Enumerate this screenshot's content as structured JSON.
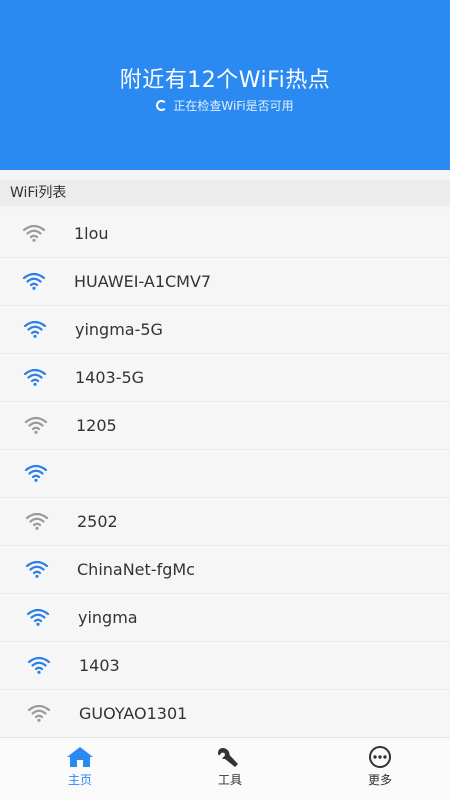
{
  "header": {
    "title": "附近有12个WiFi热点",
    "status": "正在检查WiFi是否可用"
  },
  "list": {
    "section_title": "WiFi列表",
    "items": [
      {
        "ssid": "1lou",
        "icon": "wifi-weak-icon"
      },
      {
        "ssid": "HUAWEI-A1CMV7",
        "icon": "wifi-strong-icon"
      },
      {
        "ssid": "yingma-5G",
        "icon": "wifi-strong-icon"
      },
      {
        "ssid": "1403-5G",
        "icon": "wifi-strong-icon"
      },
      {
        "ssid": "1205",
        "icon": "wifi-weak-icon"
      },
      {
        "ssid": "",
        "icon": "wifi-strong-icon"
      },
      {
        "ssid": "2502",
        "icon": "wifi-weak-icon"
      },
      {
        "ssid": "ChinaNet-fgMc",
        "icon": "wifi-strong-icon"
      },
      {
        "ssid": "yingma",
        "icon": "wifi-strong-icon"
      },
      {
        "ssid": "1403",
        "icon": "wifi-strong-icon"
      },
      {
        "ssid": "GUOYAO1301",
        "icon": "wifi-weak-icon"
      }
    ]
  },
  "tabbar": {
    "home": "主页",
    "tools": "工具",
    "more": "更多"
  },
  "colors": {
    "accent": "#2a8af2",
    "wifi_strong": "#2a7fe6",
    "wifi_weak": "#9a9a9a"
  }
}
